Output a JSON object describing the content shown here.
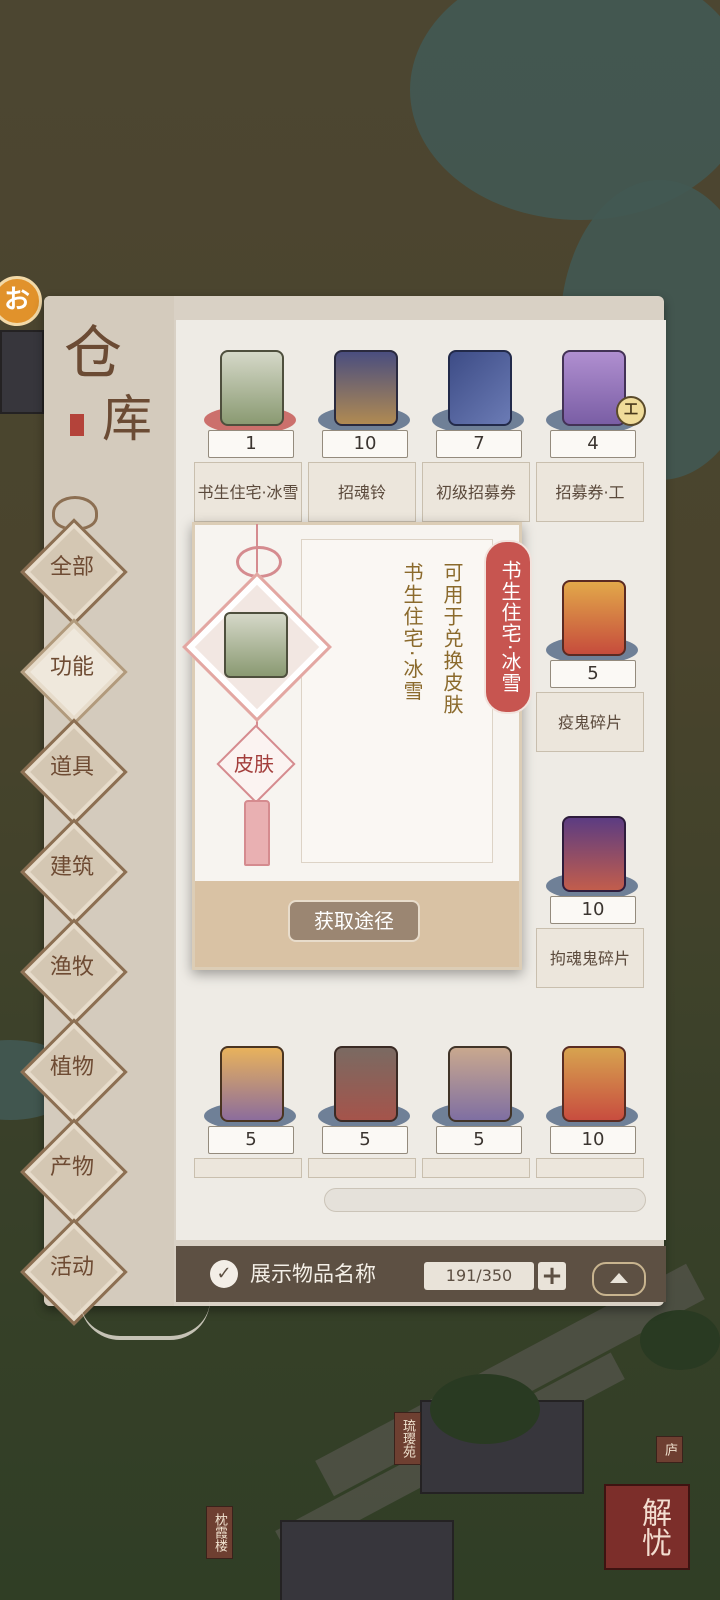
{
  "app": {
    "title_line1": "仓",
    "title_line2": "库",
    "corner_badge": "お"
  },
  "map": {
    "signs": [
      "琉璎苑",
      "枕霞楼",
      "庐"
    ],
    "seal_button": "解忧"
  },
  "categories": [
    {
      "label": "全部",
      "active": false
    },
    {
      "label": "功能",
      "active": true
    },
    {
      "label": "道具",
      "active": false
    },
    {
      "label": "建筑",
      "active": false
    },
    {
      "label": "渔牧",
      "active": false
    },
    {
      "label": "植物",
      "active": false
    },
    {
      "label": "产物",
      "active": false
    },
    {
      "label": "活动",
      "active": false
    }
  ],
  "items": [
    {
      "name": "书生住宅·冰雪",
      "count": "1",
      "icon": "building-icon",
      "rarity_color": "#c65a57"
    },
    {
      "name": "招魂铃",
      "count": "10",
      "icon": "bell-icon",
      "rarity_color": "#586d89"
    },
    {
      "name": "初级招募券",
      "count": "7",
      "icon": "book-icon",
      "rarity_color": "#586d89"
    },
    {
      "name": "招募券·工",
      "count": "4",
      "icon": "scroll-icon",
      "badge": "工",
      "rarity_color": "#586d89"
    },
    {
      "name": "疫鬼碎片",
      "count": "5",
      "icon": "ghost-fragment-icon",
      "rarity_color": "#586d89"
    },
    {
      "name": "拘魂鬼碎片",
      "count": "10",
      "icon": "ghost-fragment-icon",
      "rarity_color": "#586d89"
    },
    {
      "name": "",
      "count": "5",
      "icon": "ghost-fragment-icon",
      "rarity_color": "#586d89"
    },
    {
      "name": "",
      "count": "5",
      "icon": "ghost-fragment-icon",
      "rarity_color": "#586d89"
    },
    {
      "name": "",
      "count": "5",
      "icon": "ghost-fragment-icon",
      "rarity_color": "#586d89"
    },
    {
      "name": "",
      "count": "10",
      "icon": "ghost-fragment-icon",
      "rarity_color": "#586d89"
    }
  ],
  "popup": {
    "item_name": "书生住宅·冰雪",
    "name_col": "书生住宅·冰雪",
    "description": "可用于兑换皮肤",
    "type": "皮肤",
    "obtain_button": "获取途径"
  },
  "footer": {
    "show_names_label": "展示物品名称",
    "show_names_checked": true,
    "capacity": "191/350",
    "plus": "+"
  },
  "colors": {
    "accent_red": "#c75550",
    "panel_brown": "#5d5043"
  }
}
